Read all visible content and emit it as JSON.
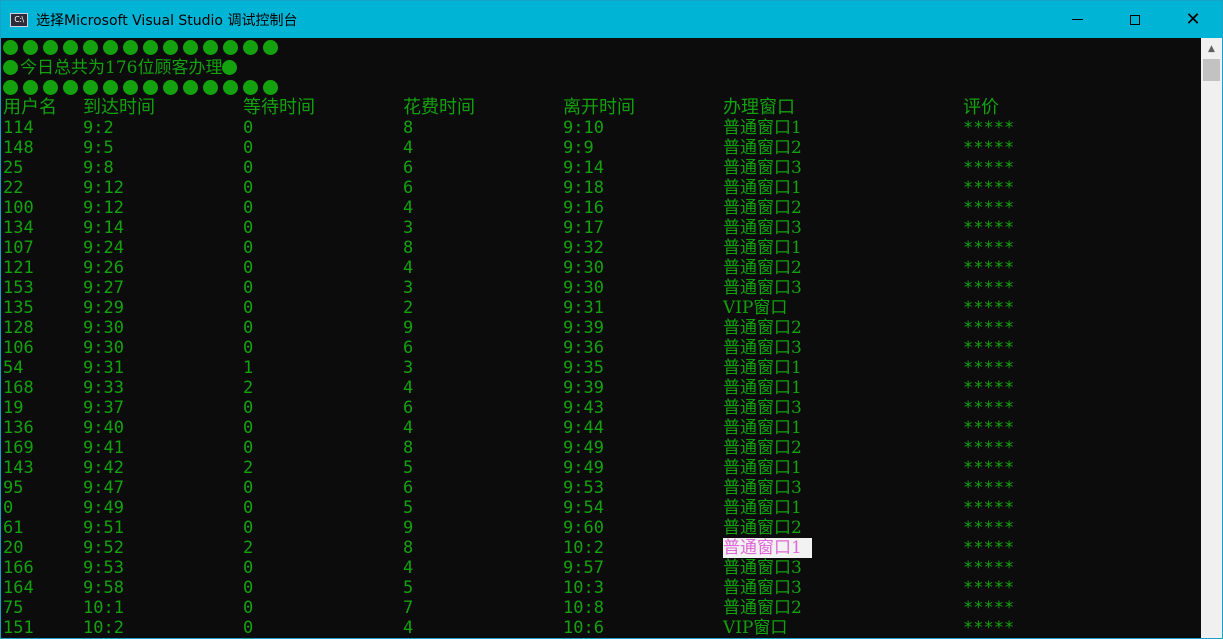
{
  "window": {
    "title": "选择Microsoft Visual Studio 调试控制台",
    "icon_label": "C:\\",
    "controls": {
      "minimize": "minimize-icon",
      "maximize": "maximize-icon",
      "close_glyph": "✕"
    }
  },
  "console": {
    "banner_dot_count": 14,
    "summary_text": "今日总共为176位顾客办理",
    "columns": [
      "用户名",
      "到达时间",
      "等待时间",
      "花费时间",
      "离开时间",
      "办理窗口",
      "评价"
    ],
    "rows": [
      [
        "114",
        "9:2",
        "0",
        "8",
        "9:10",
        "普通窗口1",
        "*****"
      ],
      [
        "148",
        "9:5",
        "0",
        "4",
        "9:9",
        "普通窗口2",
        "*****"
      ],
      [
        "25",
        "9:8",
        "0",
        "6",
        "9:14",
        "普通窗口3",
        "*****"
      ],
      [
        "22",
        "9:12",
        "0",
        "6",
        "9:18",
        "普通窗口1",
        "*****"
      ],
      [
        "100",
        "9:12",
        "0",
        "4",
        "9:16",
        "普通窗口2",
        "*****"
      ],
      [
        "134",
        "9:14",
        "0",
        "3",
        "9:17",
        "普通窗口3",
        "*****"
      ],
      [
        "107",
        "9:24",
        "0",
        "8",
        "9:32",
        "普通窗口1",
        "*****"
      ],
      [
        "121",
        "9:26",
        "0",
        "4",
        "9:30",
        "普通窗口2",
        "*****"
      ],
      [
        "153",
        "9:27",
        "0",
        "3",
        "9:30",
        "普通窗口3",
        "*****"
      ],
      [
        "135",
        "9:29",
        "0",
        "2",
        "9:31",
        "VIP窗口",
        "*****"
      ],
      [
        "128",
        "9:30",
        "0",
        "9",
        "9:39",
        "普通窗口2",
        "*****"
      ],
      [
        "106",
        "9:30",
        "0",
        "6",
        "9:36",
        "普通窗口3",
        "*****"
      ],
      [
        "54",
        "9:31",
        "1",
        "3",
        "9:35",
        "普通窗口1",
        "*****"
      ],
      [
        "168",
        "9:33",
        "2",
        "4",
        "9:39",
        "普通窗口1",
        "*****"
      ],
      [
        "19",
        "9:37",
        "0",
        "6",
        "9:43",
        "普通窗口3",
        "*****"
      ],
      [
        "136",
        "9:40",
        "0",
        "4",
        "9:44",
        "普通窗口1",
        "*****"
      ],
      [
        "169",
        "9:41",
        "0",
        "8",
        "9:49",
        "普通窗口2",
        "*****"
      ],
      [
        "143",
        "9:42",
        "2",
        "5",
        "9:49",
        "普通窗口1",
        "*****"
      ],
      [
        "95",
        "9:47",
        "0",
        "6",
        "9:53",
        "普通窗口3",
        "*****"
      ],
      [
        "0",
        "9:49",
        "0",
        "5",
        "9:54",
        "普通窗口1",
        "*****"
      ],
      [
        "61",
        "9:51",
        "0",
        "9",
        "9:60",
        "普通窗口2",
        "*****"
      ],
      [
        "20",
        "9:52",
        "2",
        "8",
        "10:2",
        "普通窗口1",
        "*****"
      ],
      [
        "166",
        "9:53",
        "0",
        "4",
        "9:57",
        "普通窗口3",
        "*****"
      ],
      [
        "164",
        "9:58",
        "0",
        "5",
        "10:3",
        "普通窗口3",
        "*****"
      ],
      [
        "75",
        "10:1",
        "0",
        "7",
        "10:8",
        "普通窗口2",
        "*****"
      ],
      [
        "151",
        "10:2",
        "0",
        "4",
        "10:6",
        "VIP窗口",
        "*****"
      ]
    ],
    "highlight_row_index": 21
  },
  "colors": {
    "console_bg": "#0c0c0c",
    "console_text": "#13a10e",
    "titlebar": "#00b4d6",
    "highlight_text": "#e068d8",
    "highlight_bg": "#f2f2f2"
  },
  "scrollbar": {
    "up_arrow_icon": "chevron-up-icon"
  }
}
